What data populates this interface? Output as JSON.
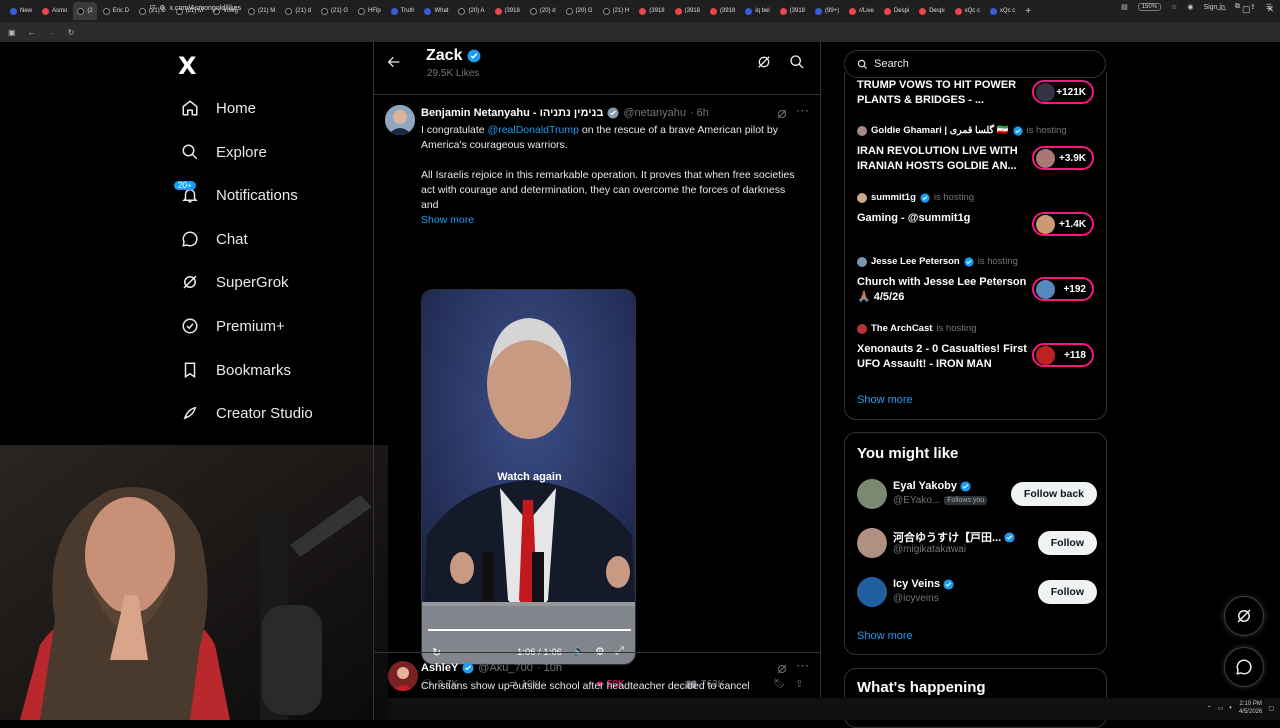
{
  "browser": {
    "tabs": [
      {
        "label": "New",
        "fav": "b"
      },
      {
        "label": "Asmo",
        "fav": "r"
      },
      {
        "label": "(2",
        "fav": "x",
        "active": true
      },
      {
        "label": "Eric D",
        "fav": "x"
      },
      {
        "label": "(21) D",
        "fav": "x"
      },
      {
        "label": "(21) M",
        "fav": "x"
      },
      {
        "label": "Viseg",
        "fav": "x"
      },
      {
        "label": "(21) M",
        "fav": "x"
      },
      {
        "label": "(21) d",
        "fav": "x"
      },
      {
        "label": "(21) G",
        "fav": "x"
      },
      {
        "label": "HFlp",
        "fav": "x"
      },
      {
        "label": "Truth",
        "fav": "b"
      },
      {
        "label": "What",
        "fav": "b"
      },
      {
        "label": "(20) A",
        "fav": "x"
      },
      {
        "label": "(3918",
        "fav": "r"
      },
      {
        "label": "(20) d",
        "fav": "x"
      },
      {
        "label": "(20) G",
        "fav": "x"
      },
      {
        "label": "(21) H",
        "fav": "x"
      },
      {
        "label": "(3918",
        "fav": "r"
      },
      {
        "label": "(3918",
        "fav": "r"
      },
      {
        "label": "(3918",
        "fav": "r"
      },
      {
        "label": "iq bel",
        "fav": "b"
      },
      {
        "label": "(3918",
        "fav": "r"
      },
      {
        "label": "(99+)",
        "fav": "b"
      },
      {
        "label": "r/Live",
        "fav": "r"
      },
      {
        "label": "Despi",
        "fav": "r"
      },
      {
        "label": "Despi",
        "fav": "r"
      },
      {
        "label": "xQc c",
        "fav": "r"
      },
      {
        "label": "xQc c",
        "fav": "b"
      }
    ],
    "url": "x.com/Asmongold/likes",
    "zoom": "150%",
    "signin": "Sign in"
  },
  "sidebar": {
    "logo": "X",
    "items": [
      {
        "label": "Home",
        "icon": "home-icon"
      },
      {
        "label": "Explore",
        "icon": "search-icon"
      },
      {
        "label": "Notifications",
        "icon": "bell-icon",
        "badge": "20+"
      },
      {
        "label": "Chat",
        "icon": "chat-icon"
      },
      {
        "label": "SuperGrok",
        "icon": "grok-icon"
      },
      {
        "label": "Premium+",
        "icon": "premium-icon"
      },
      {
        "label": "Bookmarks",
        "icon": "bookmark-icon"
      },
      {
        "label": "Creator Studio",
        "icon": "rocket-icon"
      }
    ]
  },
  "header": {
    "title": "Zack",
    "subtitle": "29.5K Likes"
  },
  "tweets": [
    {
      "name": "Benjamin Netanyahu - בנימין נתניהו",
      "handle": "@netanyahu",
      "time": "· 6h",
      "body_pre": "I congratulate ",
      "mention": "@realDonaldTrump",
      "body_post": " on the rescue of a brave American pilot by America's courageous warriors.",
      "body2": "All Israelis rejoice in this remarkable operation. It proves that when free societies act with courage and determination, they can overcome the forces of darkness and",
      "show_more": "Show more",
      "video": {
        "overlay": "Watch again",
        "time": "1:06 / 1:06",
        "progress": 1.0
      },
      "replies": "3.7K",
      "reposts": "10K",
      "likes": "50K",
      "views": "763K"
    },
    {
      "name": "AshleY",
      "handle": "@Aku_700",
      "time": "· 10h",
      "body": "Christians show up outside school after headteacher decided to cancel"
    }
  ],
  "right": {
    "search_placeholder": "Search",
    "spaces": [
      {
        "host": "",
        "hosting": "",
        "title": "TRUMP VOWS TO HIT POWER PLANTS & BRIDGES - ...",
        "count": "+121K"
      },
      {
        "host": "Goldie Ghamari | گلسا قمری 🇮🇷",
        "hosting": "is hosting",
        "title": "IRAN REVOLUTION LIVE WITH IRANIAN HOSTS GOLDIE AN...",
        "count": "+3.9K"
      },
      {
        "host": "summit1g",
        "hosting": "is hosting",
        "title": "Gaming - @summit1g",
        "count": "+1.4K"
      },
      {
        "host": "Jesse Lee Peterson",
        "hosting": "is hosting",
        "title": "Church with Jesse Lee Peterson 🙏🏽 4/5/26",
        "count": "+192"
      },
      {
        "host": "The ArchCast",
        "hosting": "is hosting",
        "title": "Xenonauts 2 - 0 Casualties! First UFO Assault! - IRON MAN",
        "count": "+118"
      }
    ],
    "spaces_show_more": "Show more",
    "you_might_like": {
      "title": "You might like",
      "users": [
        {
          "name": "Eyal Yakoby",
          "handle": "@EYako...",
          "follows_you": "Follows you",
          "button": "Follow back"
        },
        {
          "name": "河合ゆうすけ【戸田...",
          "handle": "@migikatakawai",
          "follows_you": "",
          "button": "Follow"
        },
        {
          "name": "Icy Veins",
          "handle": "@icyveins",
          "follows_you": "",
          "button": "Follow"
        }
      ],
      "show_more": "Show more"
    },
    "whats_happening": "What's happening"
  },
  "taskbar": {
    "time": "2:10 PM",
    "date": "4/5/2026"
  },
  "colors": {
    "accent": "#1d9bf0",
    "like": "#f91880",
    "bg": "#000000",
    "border": "#2f3336"
  }
}
